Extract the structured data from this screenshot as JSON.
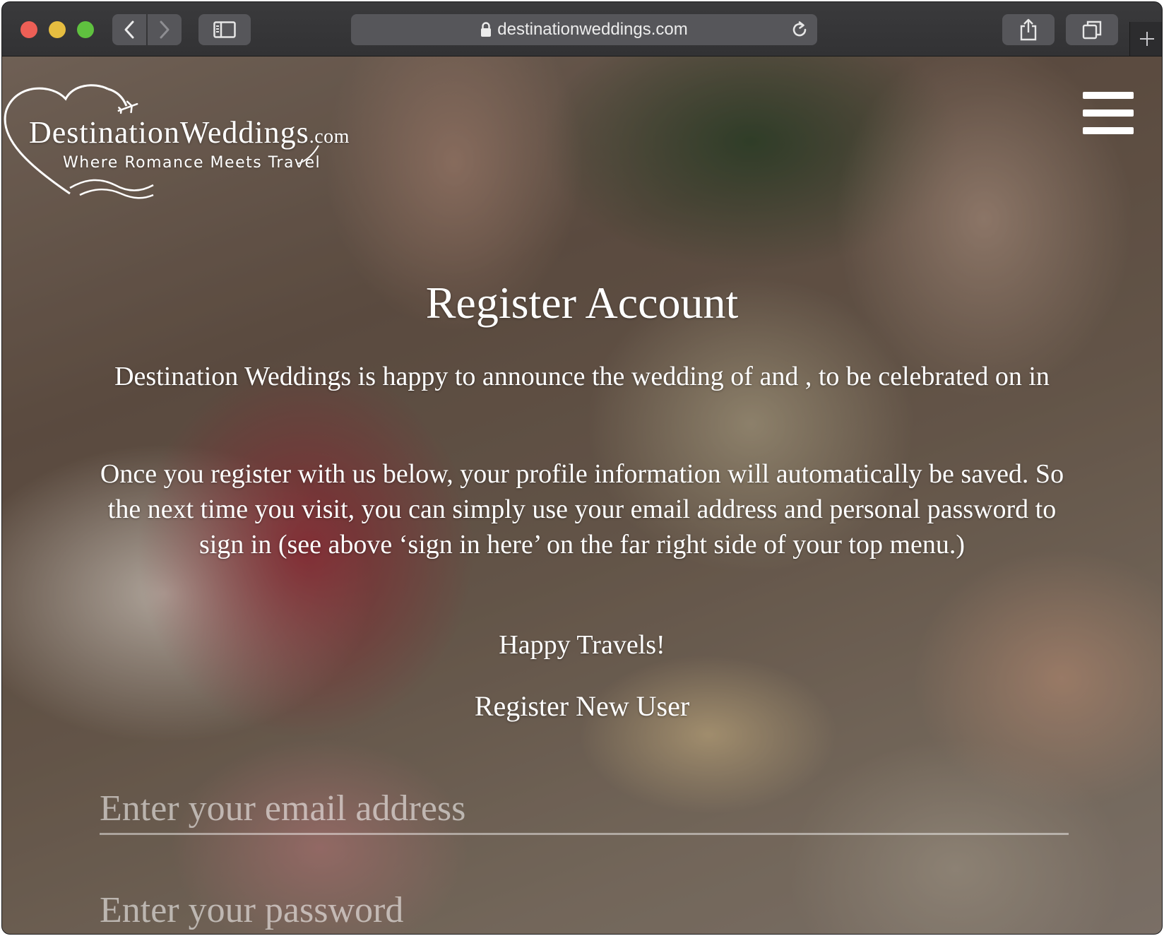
{
  "browser": {
    "url": "destinationweddings.com"
  },
  "logo": {
    "name": "DestinationWeddings",
    "suffix": ".com",
    "tagline": "Where Romance Meets Travel"
  },
  "main": {
    "title": "Register Account",
    "announcement": "Destination Weddings is happy to announce the wedding of and , to be celebrated on in",
    "instructions": "Once you register with us below, your profile information will automatically be saved. So the next time you visit, you can simply use your email address and personal password to sign in (see above ‘sign in here’ on the far right side of your top menu.)",
    "signoff": "Happy Travels!",
    "form_heading": "Register New User"
  },
  "form": {
    "email_placeholder": "Enter your email address",
    "password_placeholder": "Enter your password"
  },
  "icons": {
    "back": "chevron-left-icon",
    "forward": "chevron-right-icon",
    "sidebar": "sidebar-icon",
    "lock": "lock-icon",
    "reload": "reload-icon",
    "share": "share-icon",
    "tabs": "tabs-overview-icon",
    "new_tab": "plus-icon",
    "menu": "hamburger-menu-icon"
  },
  "colors": {
    "text": "#ffffff",
    "close": "#ed5f56",
    "minimize": "#e6bd40",
    "maximize": "#5fc13f"
  }
}
